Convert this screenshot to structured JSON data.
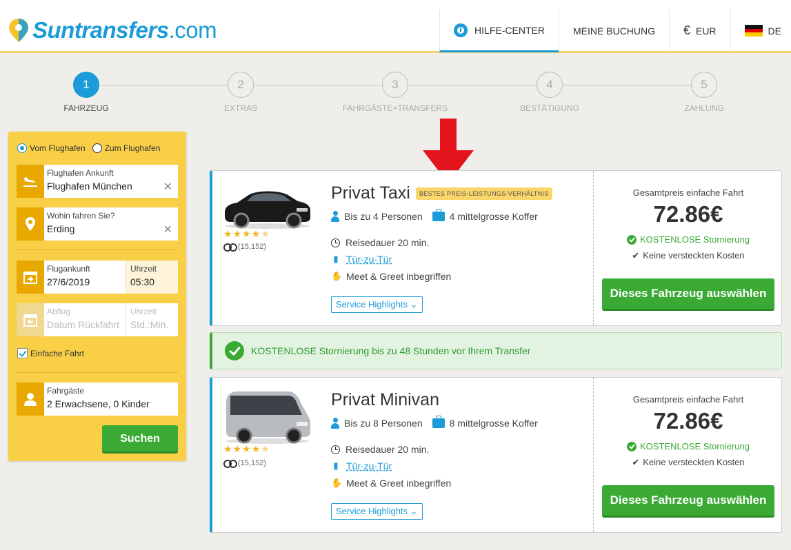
{
  "header": {
    "logo_main": "Suntransfers",
    "logo_suffix": ".com",
    "nav": {
      "help": "HILFE-CENTER",
      "booking": "MEINE BUCHUNG",
      "currency_symbol": "€",
      "currency": "EUR",
      "language": "DE"
    }
  },
  "steps": [
    {
      "number": "1",
      "label": "FAHRZEUG"
    },
    {
      "number": "2",
      "label": "EXTRAS"
    },
    {
      "number": "3",
      "label": "FAHRGÄSTE+TRANSFERS"
    },
    {
      "number": "4",
      "label": "BESTÄTIGUNG"
    },
    {
      "number": "5",
      "label": "ZAHLUNG"
    }
  ],
  "search": {
    "radio_from": "Vom Flughafen",
    "radio_to": "Zum Flughafen",
    "arrival_airport_label": "Flughafen Ankunft",
    "arrival_airport_value": "Flughafen München",
    "destination_label": "Wohin fahren Sie?",
    "destination_value": "Erding",
    "arrival_date_label": "Flugankunft",
    "arrival_date_value": "27/6/2019",
    "arrival_time_label": "Uhrzeit",
    "arrival_time_value": "05:30",
    "departure_label": "Abflug",
    "departure_placeholder": "Datum Rückfahrt",
    "departure_time_label": "Uhrzeit",
    "departure_time_placeholder": "Std.:Min.",
    "one_way_label": "Einfache Fahrt",
    "passengers_label": "Fahrgäste",
    "passengers_value": "2 Erwachsene, 0 Kinder",
    "search_button": "Suchen"
  },
  "vehicles": [
    {
      "title": "Privat Taxi",
      "badge": "BESTES PREIS-LEISTUNGS-VERHÄLTNIS",
      "persons": "Bis zu 4 Personen",
      "luggage": "4 mittelgrosse Koffer",
      "duration": "Reisedauer 20 min.",
      "door": "Tür-zu-Tür",
      "meet": "Meet & Greet inbegriffen",
      "highlights": "Service Highlights",
      "reviews": "(15,152)",
      "rating": 4.5,
      "price_label": "Gesamtpreis einfache Fahrt",
      "price": "72.86€",
      "free_cancel": "KOSTENLOSE Stornierung",
      "no_costs": "Keine versteckten Kosten",
      "select": "Dieses Fahrzeug auswählen"
    },
    {
      "title": "Privat Minivan",
      "badge": "",
      "persons": "Bis zu 8 Personen",
      "luggage": "8 mittelgrosse Koffer",
      "duration": "Reisedauer 20 min.",
      "door": "Tür-zu-Tür",
      "meet": "Meet & Greet inbegriffen",
      "highlights": "Service Highlights",
      "reviews": "(15,152)",
      "rating": 4.5,
      "price_label": "Gesamtpreis einfache Fahrt",
      "price": "72.86€",
      "free_cancel": "KOSTENLOSE Stornierung",
      "no_costs": "Keine versteckten Kosten",
      "select": "Dieses Fahrzeug auswählen"
    }
  ],
  "banner": "KOSTENLOSE Stornierung bis zu 48 Stunden vor Ihrem Transfer",
  "colors": {
    "brand_blue": "#1b9bd7",
    "accent_yellow": "#f8cf47",
    "green": "#3aaa35",
    "arrow_red": "#e3141b"
  }
}
